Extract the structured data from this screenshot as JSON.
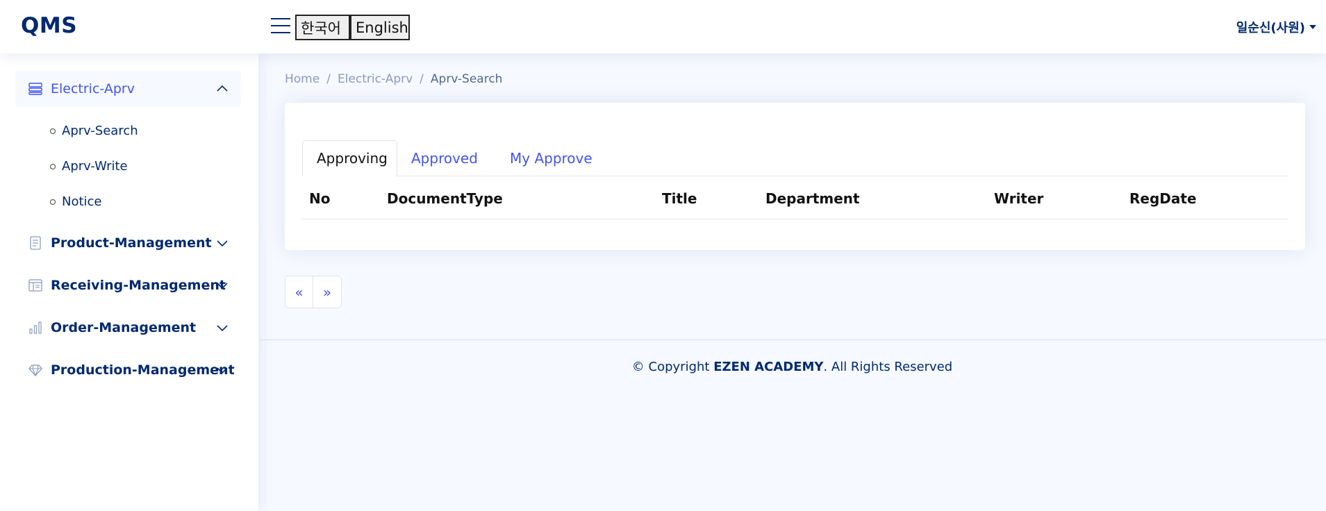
{
  "header": {
    "logo": "QMS",
    "lang_ko": "한국어",
    "lang_en": "English",
    "user": "일순신(사원)"
  },
  "sidebar": {
    "items": [
      {
        "label": "Electric-Aprv",
        "icon": "layout-list-icon",
        "expanded": true
      },
      {
        "label": "Product-Management",
        "icon": "document-list-icon"
      },
      {
        "label": "Receiving-Management",
        "icon": "layout-text-window-icon"
      },
      {
        "label": "Order-Management",
        "icon": "bar-chart-icon"
      },
      {
        "label": "Production-Management",
        "icon": "gem-icon"
      }
    ],
    "subitems": [
      "Aprv-Search",
      "Aprv-Write",
      "Notice"
    ]
  },
  "breadcrumb": [
    "Home",
    "/",
    "Electric-Aprv",
    "/",
    "Aprv-Search"
  ],
  "tabs": [
    "Approving",
    "Approved",
    "My Approve"
  ],
  "table": {
    "columns": [
      "No",
      "DocumentType",
      "Title",
      "Department",
      "Writer",
      "RegDate"
    ]
  },
  "pagination": {
    "prev": "«",
    "next": "»"
  },
  "footer": {
    "prefix": "© Copyright ",
    "brand": "EZEN ACADEMY",
    "suffix": ". All Rights Reserved"
  },
  "colors": {
    "accent": "#4154f1",
    "navy": "#012970",
    "bg": "#f6f9ff"
  }
}
